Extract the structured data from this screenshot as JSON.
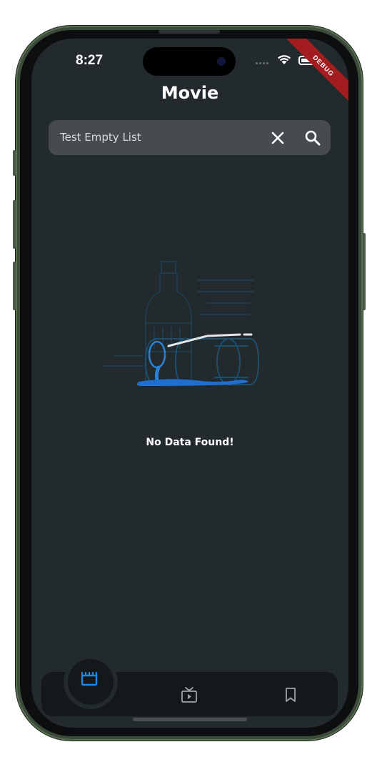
{
  "status_bar": {
    "time": "8:27",
    "debug_banner": "DEBUG"
  },
  "header": {
    "title": "Movie"
  },
  "search": {
    "value": "Test Empty List",
    "clear_icon": "close-icon",
    "search_icon": "search-icon"
  },
  "empty_state": {
    "illustration": "spilled-bottle-illustration",
    "message": "No Data Found!"
  },
  "bottom_nav": {
    "items": [
      {
        "icon": "movie-clapper-icon",
        "active": true
      },
      {
        "icon": "tv-play-icon",
        "active": false
      },
      {
        "icon": "bookmark-icon",
        "active": false
      }
    ]
  },
  "colors": {
    "background": "#222a2d",
    "search_field": "#454b4e",
    "nav_bar": "#13181a",
    "accent": "#1e88e5",
    "debug_banner": "#a31d20"
  }
}
